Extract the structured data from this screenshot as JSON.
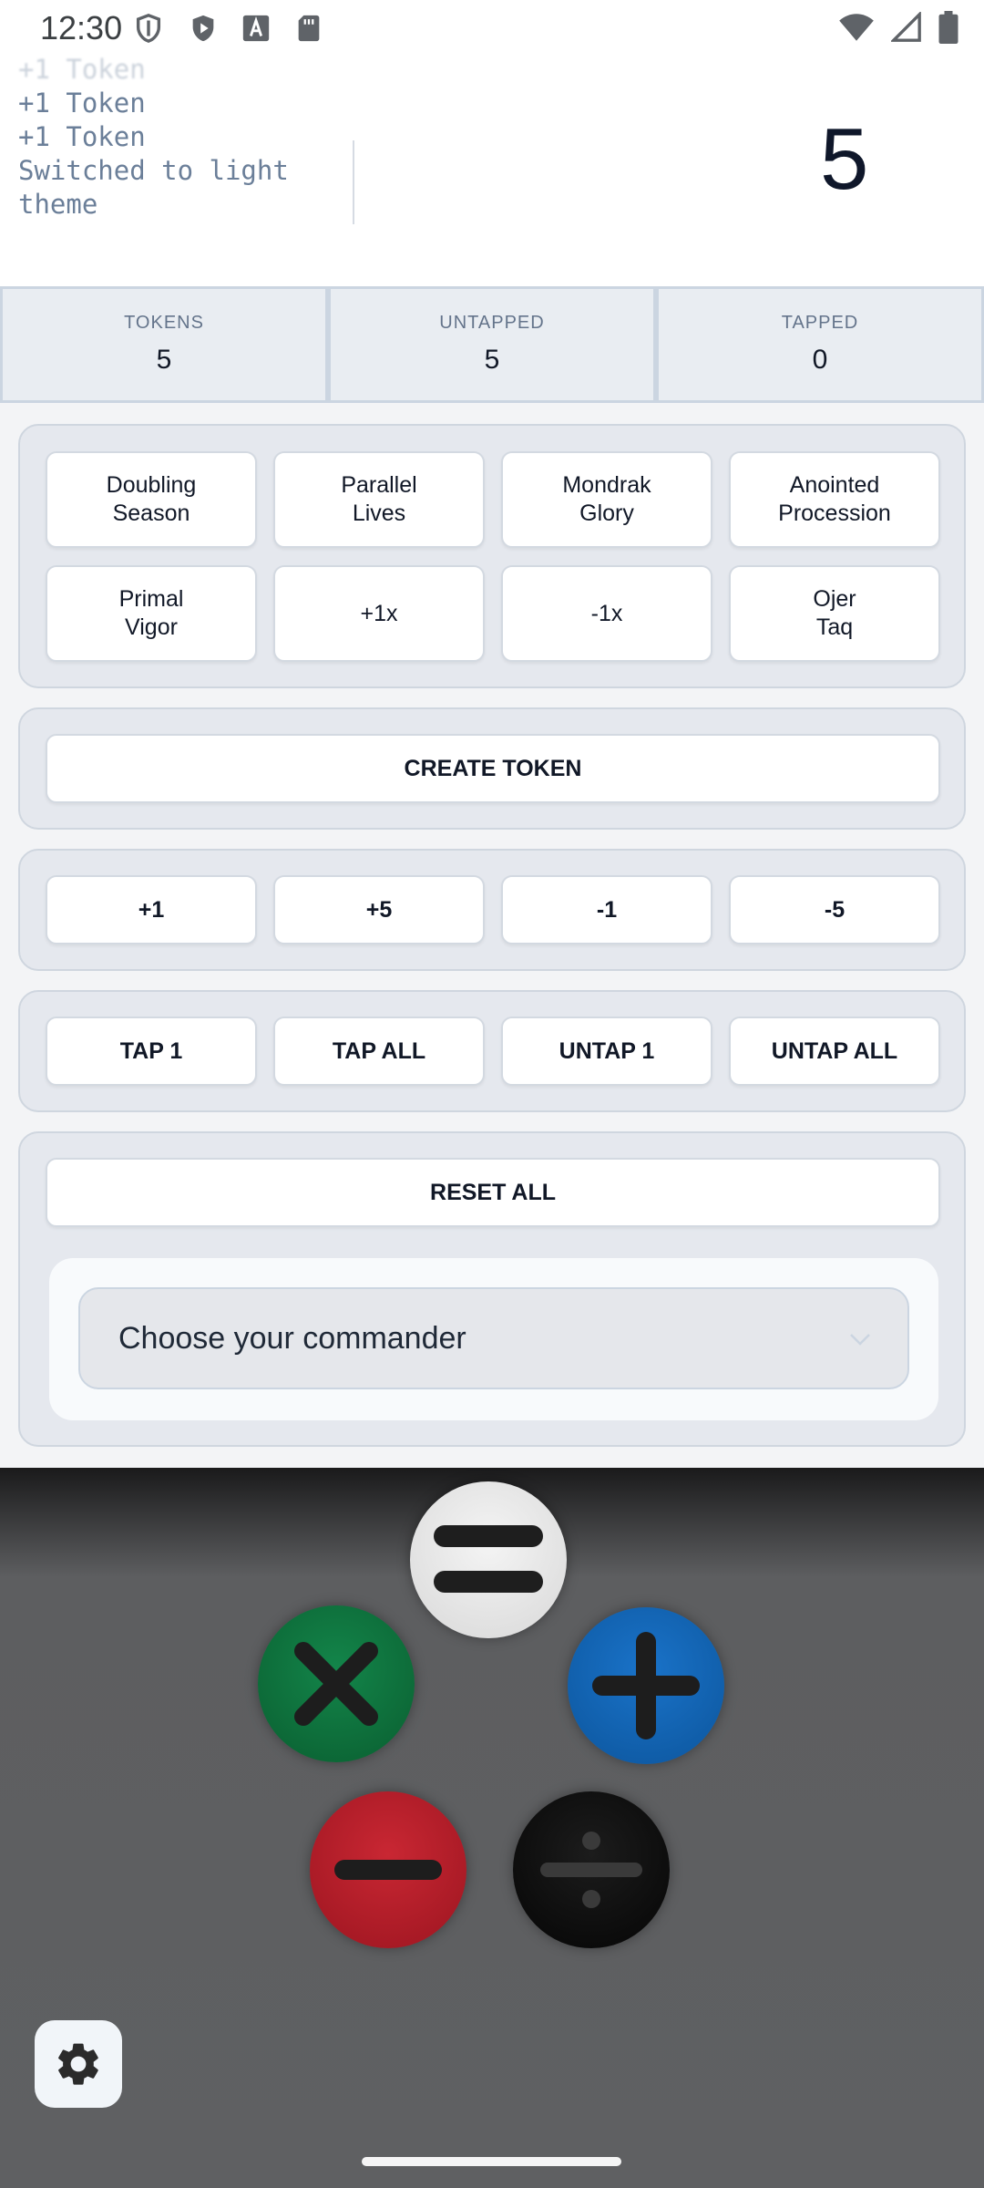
{
  "status_bar": {
    "time": "12:30",
    "left_icons": [
      "shield-icon",
      "play-shield-icon",
      "font-icon",
      "sd-card-icon"
    ],
    "right_icons": [
      "wifi-icon",
      "signal-icon",
      "battery-icon"
    ]
  },
  "log": {
    "entries": [
      "+1 Token",
      "+1 Token",
      "+1 Token",
      "Switched to light theme"
    ]
  },
  "counter": {
    "value": "5"
  },
  "stats": [
    {
      "label": "TOKENS",
      "value": "5"
    },
    {
      "label": "UNTAPPED",
      "value": "5"
    },
    {
      "label": "TAPPED",
      "value": "0"
    }
  ],
  "modifiers": [
    "Doubling\nSeason",
    "Parallel\nLives",
    "Mondrak\nGlory",
    "Anointed\nProcession",
    "Primal\nVigor",
    "+1x",
    "-1x",
    "Ojer\nTaq"
  ],
  "create": {
    "label": "CREATE TOKEN"
  },
  "adjust": [
    "+1",
    "+5",
    "-1",
    "-5"
  ],
  "tap": [
    "TAP 1",
    "TAP ALL",
    "UNTAP 1",
    "UNTAP ALL"
  ],
  "reset": {
    "label": "RESET ALL"
  },
  "commander": {
    "placeholder": "Choose your commander"
  },
  "fab": {
    "menu": {
      "icon": "menu-icon",
      "color": "#ececec"
    },
    "close": {
      "icon": "close-icon",
      "color": "#0c6b37"
    },
    "add": {
      "icon": "plus-icon",
      "color": "#0f5fae"
    },
    "minus": {
      "icon": "minus-icon",
      "color": "#b51924"
    },
    "divide": {
      "icon": "divide-icon",
      "color": "#111111"
    }
  },
  "settings": {
    "icon": "gear-icon"
  }
}
